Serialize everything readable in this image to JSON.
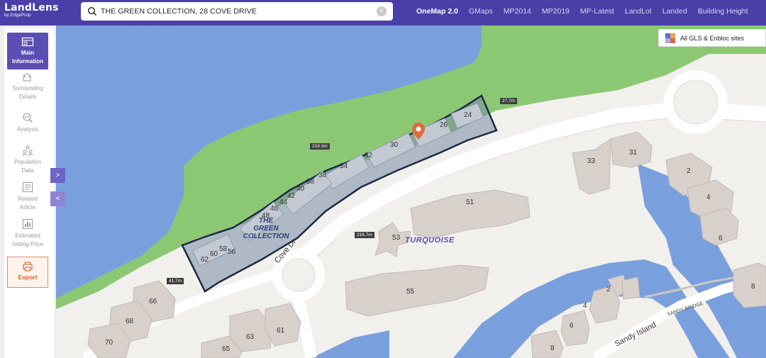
{
  "header": {
    "logo_title": "LandLens",
    "logo_subtitle": "by EdgeProp",
    "search_value": "THE GREEN COLLECTION, 28 COVE DRIVE",
    "tabs": [
      "OneMap 2.0",
      "GMaps",
      "MP2014",
      "MP2019",
      "MP-Latest",
      "LandLot",
      "Landed",
      "Building Height"
    ],
    "active_tab": "OneMap 2.0"
  },
  "sidebar": {
    "items": [
      {
        "label1": "Main",
        "label2": "Information",
        "icon": "map-icon",
        "active": true
      },
      {
        "label1": "Surrounding",
        "label2": "Details",
        "icon": "buildings-icon",
        "active": false
      },
      {
        "label1": "Analysis",
        "label2": "",
        "icon": "analysis-icon",
        "active": false
      },
      {
        "label1": "Population",
        "label2": "Data",
        "icon": "people-icon",
        "active": false
      },
      {
        "label1": "Related",
        "label2": "Article",
        "icon": "article-icon",
        "active": false
      },
      {
        "label1": "Estimated",
        "label2": "Selling Price",
        "icon": "price-icon",
        "active": false
      }
    ],
    "export_label": "Export",
    "expand_glyph": ">",
    "collapse_glyph": "<"
  },
  "legend": {
    "label": "All GLS & Enbloc sites",
    "colors": [
      "#5b6fd0",
      "#e9a15b",
      "#b4a9d9",
      "#d2684f"
    ]
  },
  "map": {
    "colors": {
      "water": "#7a9fdd",
      "grass": "#8cc873",
      "land": "#f2f0ed",
      "road": "#ffffff",
      "building": "#d8d0cb",
      "plot_fill": "#a9b4c4",
      "plot_stroke": "#1b2a44",
      "pin": "#e06a3c"
    },
    "plot_name_lines": [
      "THE",
      "GREEN",
      "COLLECTION"
    ],
    "place_label": "TURQUOISE",
    "roads": {
      "cove": "Cove Dr",
      "sandy": "Sandy Island",
      "bridge": "SANDY BRIDGE"
    },
    "measures": {
      "m1": "27.7m",
      "m2": "219.3m",
      "m3": "216.7m",
      "m4": "41.7m"
    },
    "plot_unit_numbers": [
      "24",
      "26",
      "30",
      "32",
      "34",
      "36",
      "38",
      "40",
      "42",
      "44",
      "46",
      "48",
      "56",
      "58",
      "60",
      "62"
    ],
    "block_numbers": {
      "b33": "33",
      "b31": "31",
      "b2a": "2",
      "b4a": "4",
      "b6a": "6",
      "b51": "51",
      "b53": "53",
      "b55": "55",
      "b66": "66",
      "b68": "68",
      "b70": "70",
      "b65": "65",
      "b63": "63",
      "b61": "61",
      "b2b": "2",
      "b4b": "4",
      "b6b": "6",
      "b8b": "8",
      "b8c": "8"
    }
  }
}
